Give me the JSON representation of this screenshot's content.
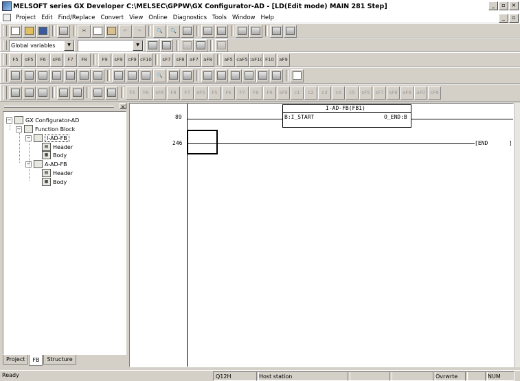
{
  "title": "MELSOFT series GX Developer C:\\MELSEC\\GPPW\\GX Configurator-AD - [LD(Edit mode)   MAIN   281 Step]",
  "menu": [
    "Project",
    "Edit",
    "Find/Replace",
    "Convert",
    "View",
    "Online",
    "Diagnostics",
    "Tools",
    "Window",
    "Help"
  ],
  "toolbar": {
    "global_vars": "Global variables",
    "second_combo": "",
    "fkeys_row1": [
      "F5",
      "sF5",
      "F6",
      "sF6",
      "F7",
      "F8",
      "F9",
      "sF9",
      "cF9",
      "cF10",
      "sF7",
      "sF8",
      "aF7",
      "aF8",
      "aF5",
      "caF5",
      "caF10",
      "F10",
      "aF9"
    ],
    "fkeys_row4": [
      "F5",
      "F6",
      "sF6",
      "F8",
      "F7",
      "sF5",
      "F5",
      "F6",
      "F7",
      "F8",
      "F9",
      "sF9",
      "c1",
      "c2",
      "c3",
      "c4",
      "c5",
      "sF5",
      "sF7",
      "sF8",
      "aF8",
      "aF0",
      "cF8"
    ]
  },
  "project": {
    "tree": [
      {
        "label": "GX Configurator-AD",
        "icon": "project-icon"
      },
      {
        "label": "Function Block",
        "icon": "folder-icon"
      },
      {
        "label": "I-AD-FB",
        "icon": "fb-icon"
      },
      {
        "label": "Header",
        "icon": "header-icon"
      },
      {
        "label": "Body",
        "icon": "body-icon"
      },
      {
        "label": "A-AD-FB",
        "icon": "fb-icon"
      },
      {
        "label": "Header",
        "icon": "header-icon"
      },
      {
        "label": "Body",
        "icon": "body-icon"
      }
    ],
    "tabs": [
      "Project",
      "FB",
      "Structure"
    ]
  },
  "ladder": {
    "step1": "89",
    "fb_title": "I-AD-FB(FB1)",
    "fb_in": "B:I_START",
    "fb_out": "O_END:B",
    "step2": "246",
    "end": "END"
  },
  "status": {
    "ready": "Ready",
    "cpu": "Q12H",
    "station": "Host station",
    "mode": "Ovrwrte",
    "num": "NUM"
  }
}
